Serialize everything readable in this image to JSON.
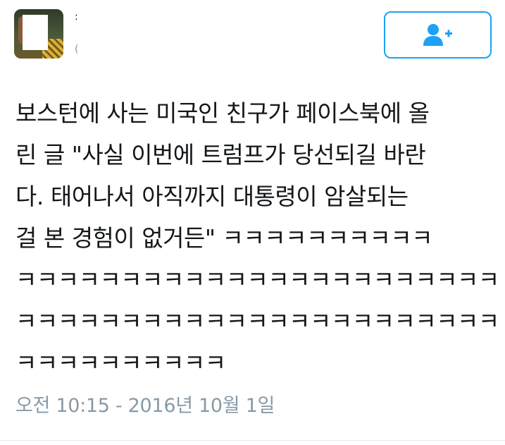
{
  "header": {
    "name": ":",
    "handle": "(",
    "follow_icon": "follow-person-plus-icon"
  },
  "tweet": {
    "lines": [
      "보스턴에 사는 미국인 친구가 페이스북에 올",
      "린 글 \"사실 이번에 트럼프가 당선되길 바란",
      "다. 태어나서 아직까지 대통령이 암살되는",
      "걸 본 경험이 없거든\" ㅋㅋㅋㅋㅋㅋㅋㅋㅋㅋ",
      "ㅋㅋㅋㅋㅋㅋㅋㅋㅋㅋㅋㅋㅋㅋㅋㅋㅋㅋㅋㅋㅋㅋㅋ",
      "ㅋㅋㅋㅋㅋㅋㅋㅋㅋㅋㅋㅋㅋㅋㅋㅋㅋㅋㅋㅋㅋㅋㅋ",
      "ㅋㅋㅋㅋㅋㅋㅋㅋㅋㅋ"
    ],
    "timestamp": "오전 10:15 - 2016년 10월 1일"
  },
  "colors": {
    "accent": "#1da1f2",
    "text": "#14171a",
    "muted": "#8899a6"
  }
}
